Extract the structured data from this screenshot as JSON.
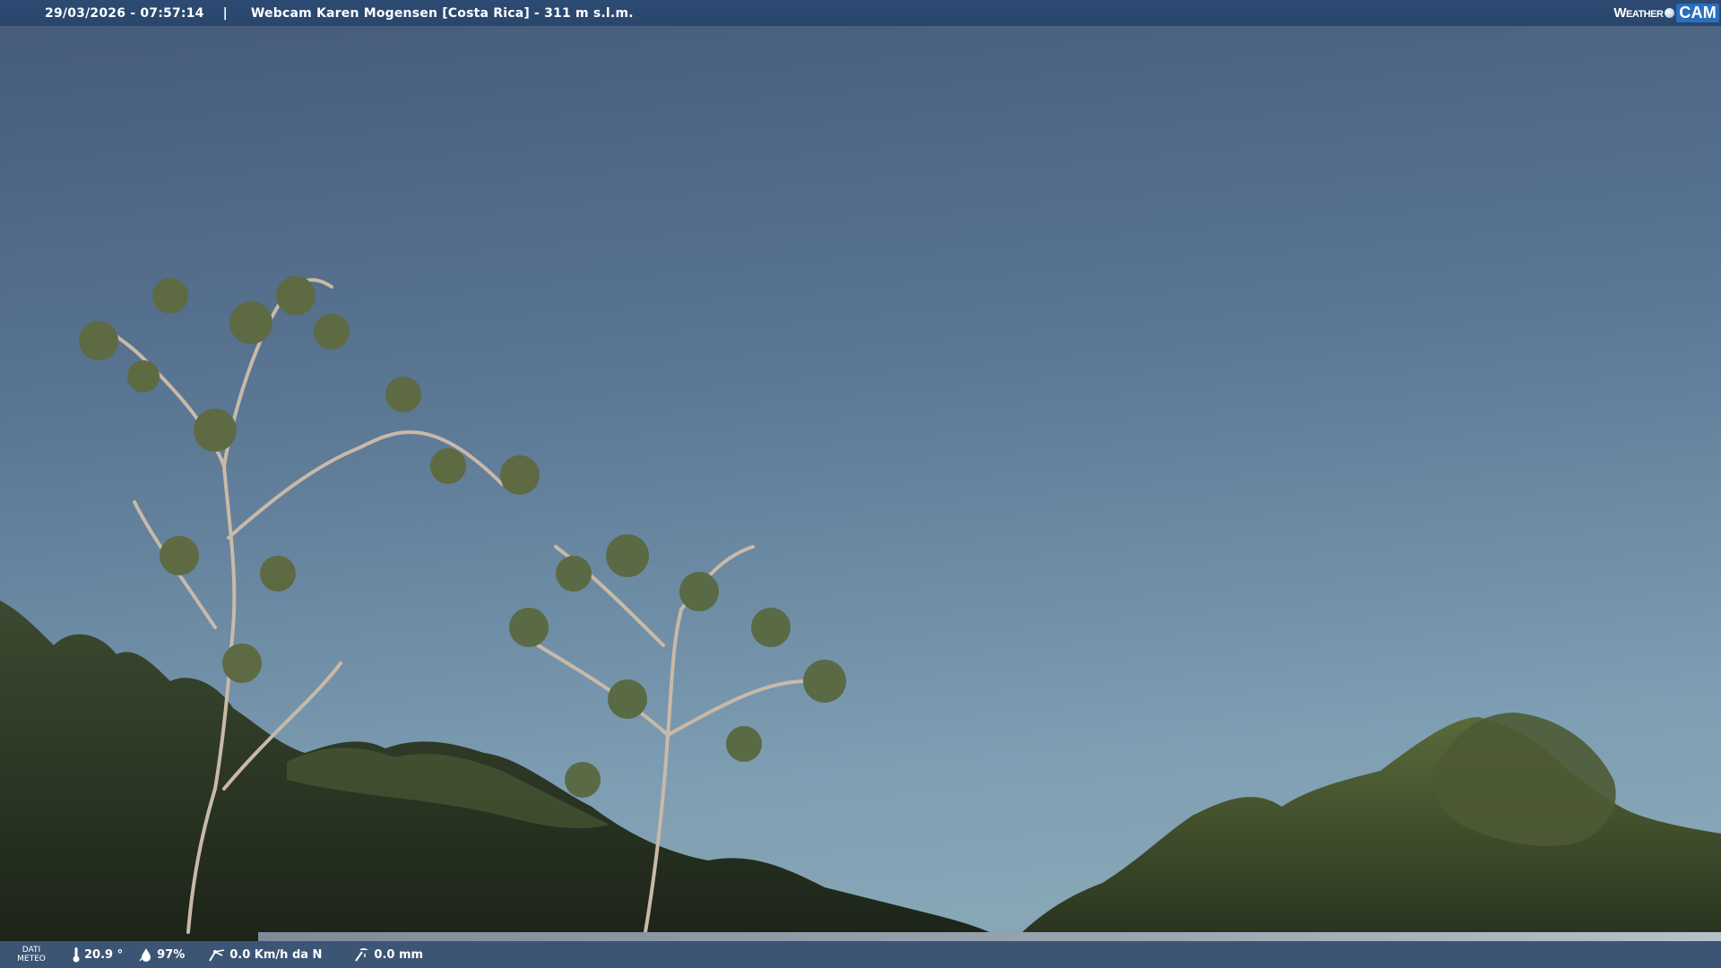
{
  "header": {
    "datetime": "29/03/2026 - 07:57:14",
    "separator": "|",
    "title": "Webcam Karen Mogensen [Costa Rica] - 311 m s.l.m."
  },
  "logo": {
    "brand_left": "Weather",
    "brand_right": "CAM"
  },
  "footer": {
    "meteo_label_line1": "DATI",
    "meteo_label_line2": "METEO",
    "temperature": "20.9 °",
    "humidity": "97%",
    "wind": "0.0 Km/h da N",
    "rain": "0.0 mm"
  },
  "colors": {
    "sky_top": "#445a78",
    "sky_bottom": "#7a9ab0",
    "bar": "#2c4a72"
  }
}
